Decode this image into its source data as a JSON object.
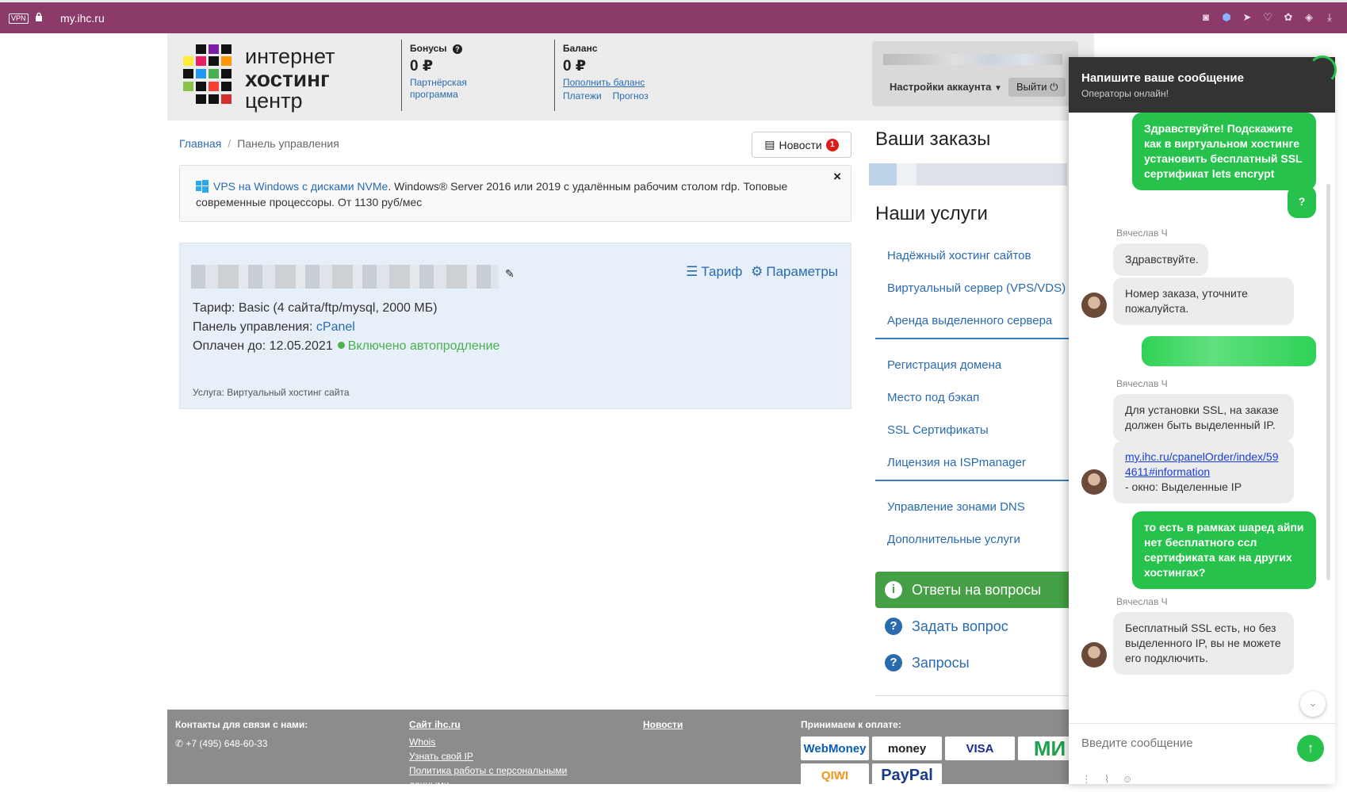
{
  "browser": {
    "vpn_label": "VPN",
    "url": "my.ihc.ru",
    "toolbar_icons": [
      "camera-icon",
      "shield-icon",
      "send-icon",
      "heart-icon",
      "extension-icon",
      "cube-icon",
      "download-icon"
    ]
  },
  "logo": {
    "line1": "интернет",
    "line2": "хостинг",
    "line3": "центр"
  },
  "header": {
    "bonus": {
      "label": "Бонусы",
      "amount": "0 ₽",
      "link": "Партнёрская программа"
    },
    "balance": {
      "label": "Баланс",
      "amount": "0 ₽",
      "topup": "Пополнить баланс",
      "payments": "Платежи",
      "forecast": "Прогноз"
    },
    "account": {
      "settings": "Настройки аккаунта",
      "logout": "Выйти"
    }
  },
  "breadcrumb": {
    "home": "Главная",
    "current": "Панель управления"
  },
  "news_button": {
    "label": "Новости",
    "count": "1"
  },
  "alert": {
    "link": "VPS на Windows с дисками NVMe",
    "text": ". Windows® Server 2016 или 2019 с удалённым рабочим столом rdp. Топовые современные процессоры. От 1130 руб/мес",
    "close": "×"
  },
  "service": {
    "tariff_link": "Тариф",
    "params_link": "Параметры",
    "tariff_label": "Тариф:",
    "tariff_value": "Basic (4 сайта/ftp/mysql, 2000 МБ)",
    "panel_label": "Панель управления:",
    "panel_value": "cPanel",
    "paid_label": "Оплачен до:",
    "paid_value": "12.05.2021",
    "autorenew": "Включено автопродление",
    "service_type": "Услуга: Виртуальный хостинг сайта"
  },
  "sidebar": {
    "orders_title": "Ваши заказы",
    "services_title": "Наши услуги",
    "services": [
      "Надёжный хостинг сайтов",
      "Виртуальный сервер (VPS/VDS)",
      "Аренда выделенного сервера",
      "Регистрация домена",
      "Место под бэкап",
      "SSL Сертификаты",
      "Лицензия на ISPmanager",
      "Управление зонами DNS",
      "Дополнительные услуги"
    ],
    "faq": "Ответы на вопросы",
    "ask": "Задать вопрос",
    "requests": "Запросы"
  },
  "footer": {
    "contacts_title": "Контакты для связи с нами:",
    "phone": "+7 (495) 648-60-33",
    "site_title": "Сайт ihc.ru",
    "site_links": [
      "Whois",
      "Узнать свой IP",
      "Политика работы с персональными данными"
    ],
    "news": "Новости",
    "payment_title": "Принимаем к оплате:",
    "payment_methods": [
      "WebMoney",
      "money",
      "VISA",
      "МИ",
      "QIWI",
      "PayPal"
    ]
  },
  "chat": {
    "title": "Напишите ваше сообщение",
    "subtitle": "Операторы онлайн!",
    "operator_name": "Вячеслав Ч",
    "messages": {
      "m1": "Здравствуйте! Подскажите как в виртуальном хостинге установить бесплатный SSL сертификат lets encrypt",
      "m2": "?",
      "m3": "Здравствуйте.",
      "m4": "Номер заказа, уточните пожалуйста.",
      "m5": "Для установки SSL, на заказе должен быть выделенный IP.",
      "m6_link": "my.ihc.ru/cpanelOrder/index/594611#information",
      "m6_text": "- окно: Выделенные IP",
      "m7": "то есть в рамках шаред айпи нет бесплатного ссл сертификата как на других хостингах?",
      "m8": "Бесплатный SSL есть, но без выделенного IP, вы не можете его подключить."
    },
    "input_placeholder": "Введите сообщение"
  }
}
